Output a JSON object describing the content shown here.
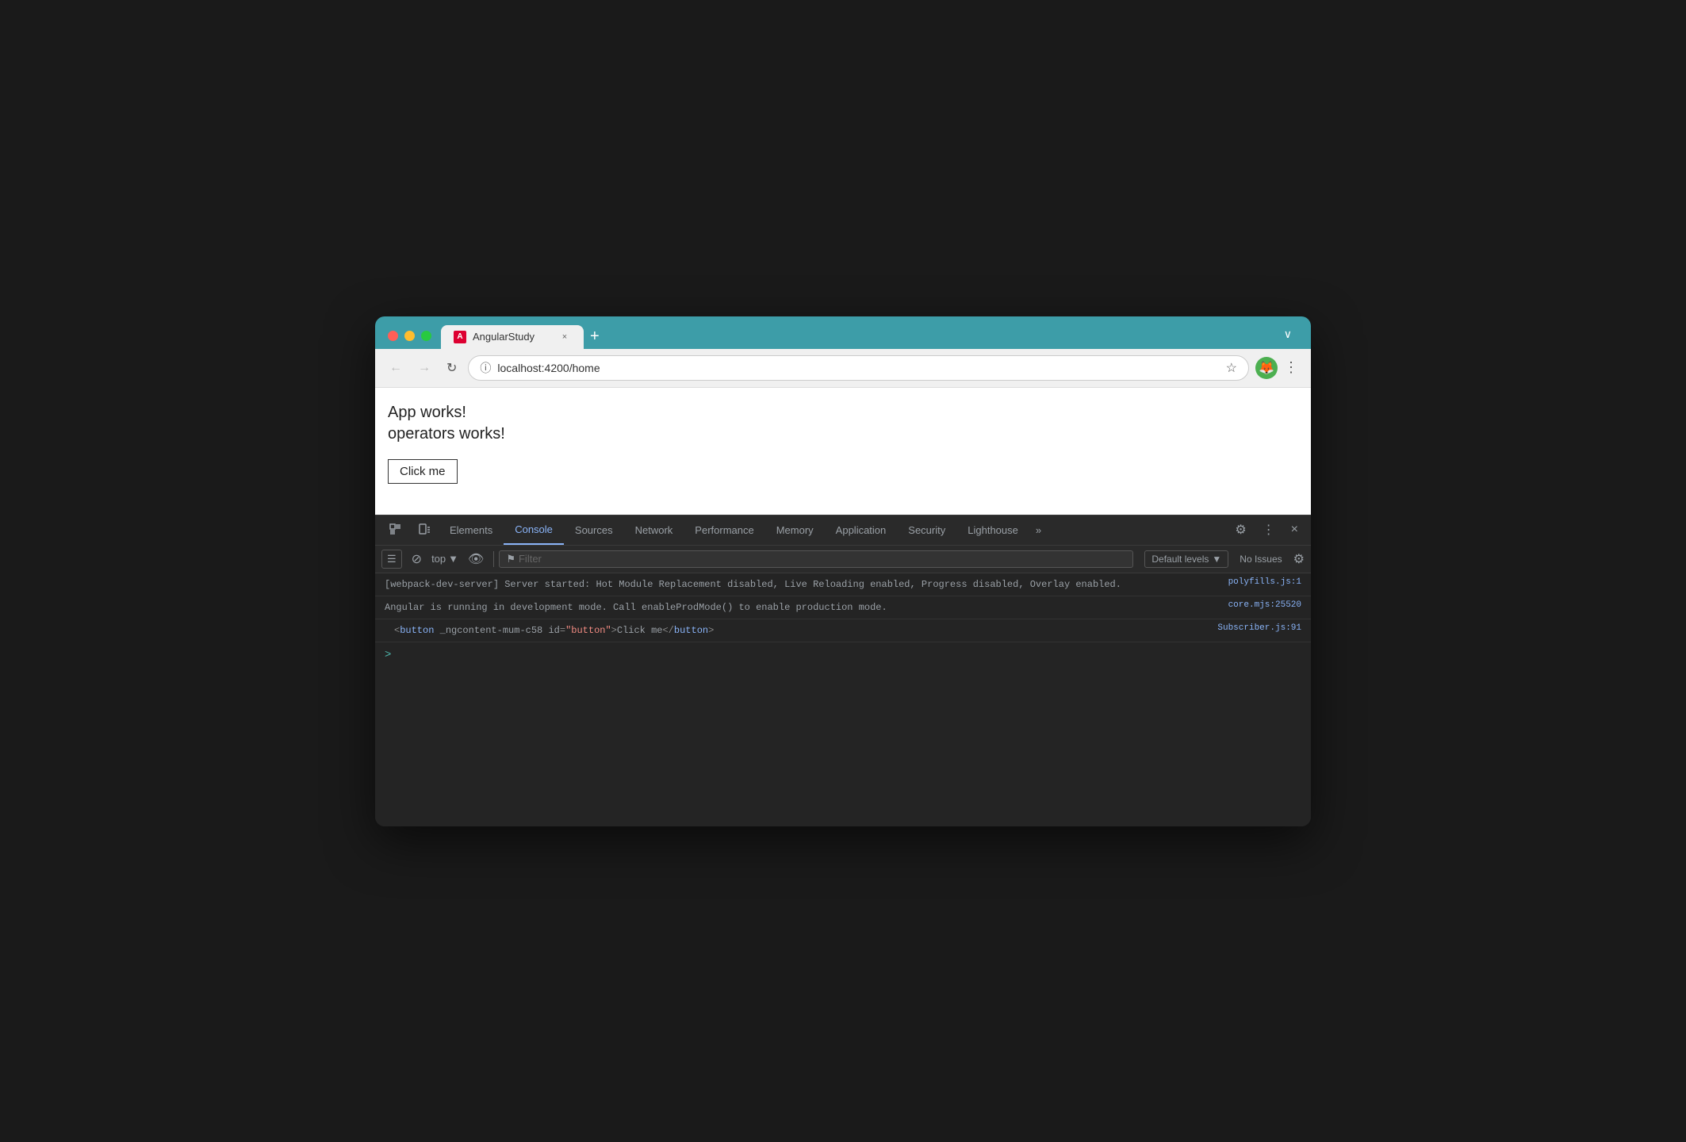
{
  "browser": {
    "controls": {
      "close_label": "×",
      "min_label": "−",
      "max_label": "+"
    },
    "tab": {
      "title": "AngularStudy",
      "favicon_letter": "A",
      "new_tab_label": "+",
      "expand_label": "∨"
    },
    "nav": {
      "back_label": "←",
      "forward_label": "→",
      "reload_label": "↻",
      "url": "localhost:4200/home",
      "star_label": "☆",
      "avatar_label": "🦊",
      "more_label": "⋮"
    }
  },
  "page": {
    "line1": "App works!",
    "line2": "operators works!",
    "button_label": "Click me"
  },
  "devtools": {
    "tabs": [
      {
        "label": "Elements",
        "active": false
      },
      {
        "label": "Console",
        "active": true
      },
      {
        "label": "Sources",
        "active": false
      },
      {
        "label": "Network",
        "active": false
      },
      {
        "label": "Performance",
        "active": false
      },
      {
        "label": "Memory",
        "active": false
      },
      {
        "label": "Application",
        "active": false
      },
      {
        "label": "Security",
        "active": false
      },
      {
        "label": "Lighthouse",
        "active": false
      }
    ],
    "more_tabs_label": "»",
    "settings_icon": "⚙",
    "more_icon": "⋮",
    "close_icon": "×",
    "console_toolbar": {
      "sidebar_icon": "☰",
      "ban_icon": "⊘",
      "context_label": "top",
      "context_arrow": "▼",
      "eye_icon": "👁",
      "filter_placeholder": "Filter",
      "filter_icon": "⚑",
      "default_levels_label": "Default levels",
      "default_levels_arrow": "▼",
      "no_issues_label": "No Issues",
      "settings_icon": "⚙"
    },
    "console_lines": [
      {
        "text": "[webpack-dev-server] Server started: Hot Module Replacement disabled, Live Reloading enabled, Progress disabled, Overlay enabled.",
        "link": "polyfills.js:1"
      },
      {
        "text": "Angular is running in development mode. Call enableProdMode() to enable production mode.",
        "link": "core.mjs:25520"
      }
    ],
    "html_output": {
      "open_tag": "<",
      "tag_name": "button",
      "attr1_name": " _ngcontent-mum-c58",
      "attr2_name": " id",
      "attr2_eq": "=",
      "attr2_value": "\"button\"",
      "close_bracket": ">",
      "inner_text": "Click me",
      "close_tag": "</button>",
      "link": "Subscriber.js:91"
    },
    "prompt_symbol": ">"
  }
}
